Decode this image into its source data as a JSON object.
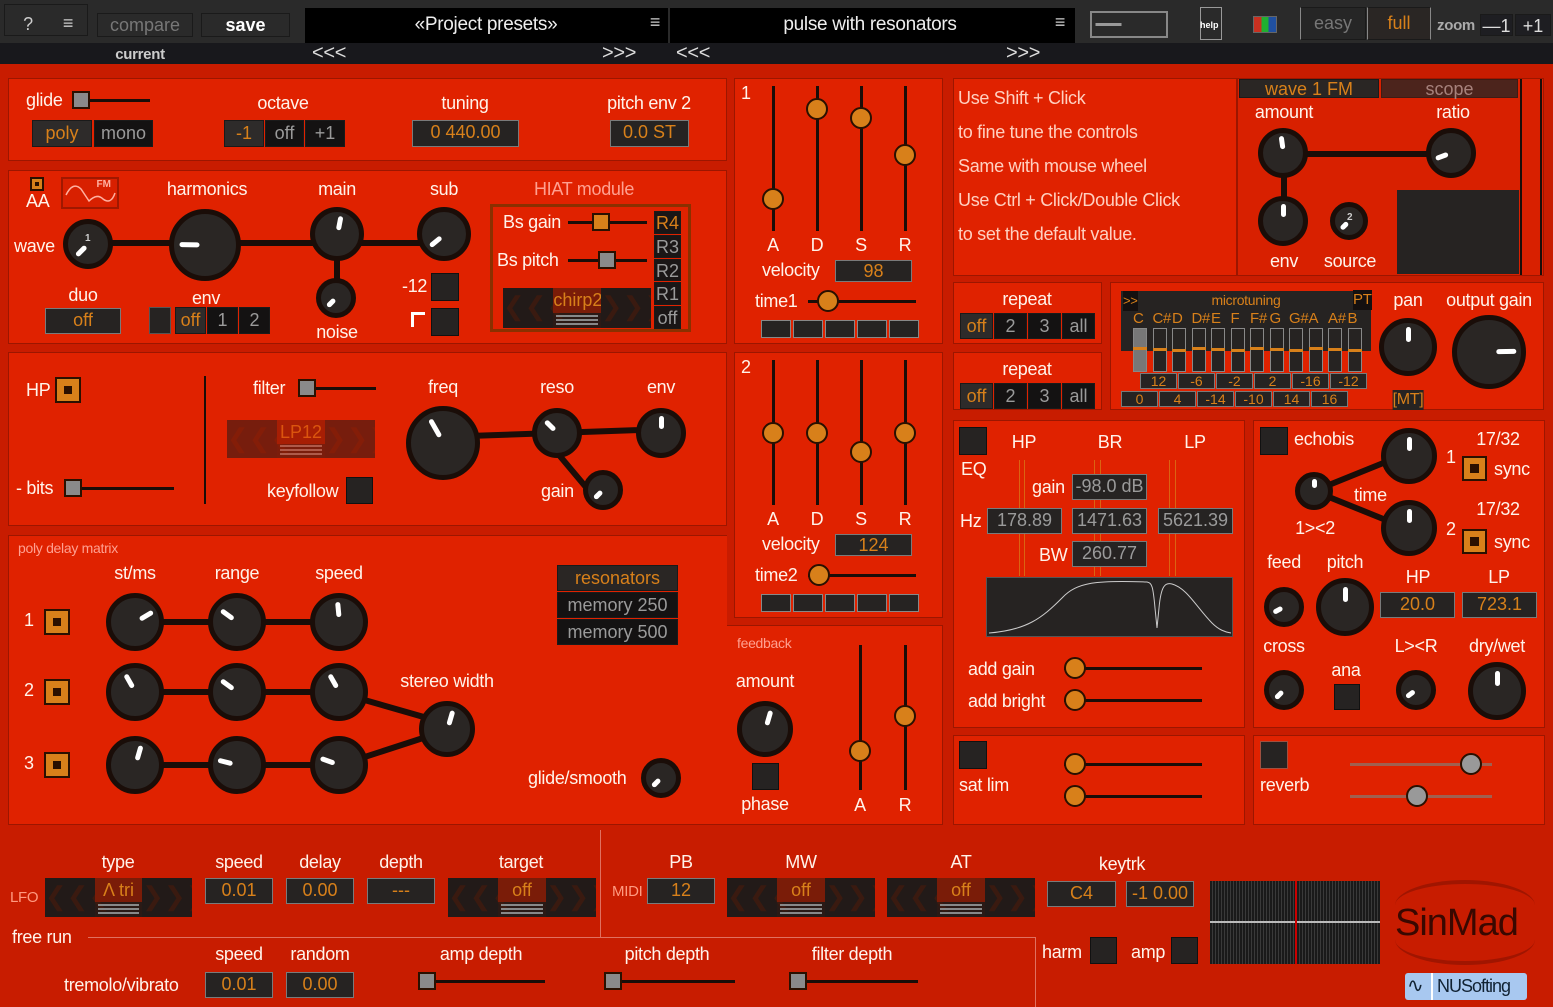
{
  "colors": {
    "panel": "#e02200",
    "background": "#c81c00",
    "accent": "#d8801a",
    "display": "#262322"
  },
  "header": {
    "help": "?",
    "menu": "≡",
    "compare": "compare",
    "save": "save",
    "current": "current",
    "preset_bank": "«Project presets»",
    "preset_name": "pulse with resonators",
    "prev": "<<<",
    "next": ">>>",
    "help_doc": "help",
    "mode_easy": "easy",
    "mode_full": "full",
    "zoom_label": "zoom",
    "zoom_minus": "—1",
    "zoom_plus": "+1"
  },
  "voice": {
    "glide": "glide",
    "glide_value": 0,
    "poly": "poly",
    "mono": "mono",
    "octave": "octave",
    "octave_options": [
      "-1",
      "off",
      "+1"
    ],
    "tuning": "tuning",
    "tuning_value": "0 440.00",
    "pitch_env2": "pitch env 2",
    "pitch_env2_value": "0.0 ST"
  },
  "osc": {
    "aa": "AA",
    "fm": "FM",
    "harmonics": "harmonics",
    "main": "main",
    "sub": "sub",
    "wave": "wave",
    "wave_num": "1",
    "duo": "duo",
    "duo_value": "off",
    "env": "env",
    "env_options": [
      "off",
      "1",
      "2"
    ],
    "noise": "noise",
    "minus12": "-12",
    "knobs": {
      "wave": 0,
      "harmonics": 0.17,
      "main": 0.54,
      "sub": 0.02,
      "noise": 0
    }
  },
  "hiat": {
    "title": "HIAT module",
    "bs_gain": "Bs gain",
    "bs_gain_value": 0.4,
    "bs_pitch": "Bs pitch",
    "bs_pitch_value": 0.5,
    "model": "chirp2",
    "r_buttons": [
      "R4",
      "R3",
      "R2",
      "R1",
      "off"
    ],
    "active": "R4"
  },
  "filter": {
    "hp": "HP",
    "filter": "filter",
    "filter_value": 0,
    "freq": "freq",
    "reso": "reso",
    "env": "env",
    "bits": "- bits",
    "bits_value": 0,
    "keyfollow": "keyfollow",
    "gain": "gain",
    "type": "LP12",
    "knobs": {
      "freq": 0.39,
      "reso": 0.33,
      "env": 0.5,
      "gain": 0
    }
  },
  "delay": {
    "title": "poly delay matrix",
    "st_ms": "st/ms",
    "range": "range",
    "speed": "speed",
    "rows": [
      "1",
      "2",
      "3"
    ],
    "knobs": [
      [
        0.72,
        0.3,
        0.48
      ],
      [
        0.39,
        0.3,
        0.39
      ],
      [
        0.56,
        0.22,
        0.24
      ]
    ],
    "stereo_width": "stereo width",
    "stereo_width_value": 0.56,
    "resonators": [
      "resonators",
      "memory 250",
      "memory 500"
    ],
    "glide_smooth": "glide/smooth",
    "glide_smooth_value": 0
  },
  "feedback": {
    "title": "feedback",
    "amount": "amount",
    "amount_value": 0.56,
    "phase": "phase",
    "a": "A",
    "r": "R",
    "a_value": 0.23,
    "r_value": 0.51
  },
  "env1": {
    "number": "1",
    "labels": [
      "A",
      "D",
      "S",
      "R"
    ],
    "values": [
      0.17,
      0.9,
      0.83,
      0.53
    ],
    "velocity": "velocity",
    "velocity_value": "98",
    "time": "time1",
    "time_value": 0.1
  },
  "env2": {
    "number": "2",
    "labels": [
      "A",
      "D",
      "S",
      "R"
    ],
    "values": [
      0.5,
      0.5,
      0.34,
      0.5
    ],
    "velocity": "velocity",
    "velocity_value": "124",
    "time": "time2",
    "time_value": 0
  },
  "info": {
    "lines": [
      "Use Shift + Click",
      "to fine tune the controls",
      "Same with mouse wheel",
      "Use Ctrl + Click/Double Click",
      "to set the default value."
    ]
  },
  "fm": {
    "tabs": [
      "wave 1 FM",
      "scope"
    ],
    "amount": "amount",
    "ratio": "ratio",
    "env": "env",
    "source": "source",
    "source_num": "2",
    "knobs": {
      "amount": 0.47,
      "ratio": 0.09,
      "env": 0.5,
      "source": 0
    }
  },
  "repeat1": {
    "label": "repeat",
    "options": [
      "off",
      "2",
      "3",
      "all"
    ]
  },
  "repeat2": {
    "label": "repeat",
    "options": [
      "off",
      "2",
      "3",
      "all"
    ]
  },
  "micro": {
    "toggle": ">>",
    "title": "microtuning",
    "pt": "PT",
    "notes": [
      "C",
      "C#",
      "D",
      "D#",
      "E",
      "F",
      "F#",
      "G",
      "G#",
      "A",
      "A#",
      "B"
    ],
    "row1": [
      "12",
      "-6",
      "-2",
      "2",
      "-16",
      "-12"
    ],
    "row2": [
      "0",
      "4",
      "-14",
      "-10",
      "14",
      "16"
    ],
    "pan": "pan",
    "output_gain": "output gain",
    "mt": "[MT]",
    "pan_value": 0.5,
    "output_gain_value": 0.83
  },
  "eq": {
    "eq": "EQ",
    "hp": "HP",
    "br": "BR",
    "lp": "LP",
    "gain": "gain",
    "gain_value": "-98.0 dB",
    "hz": "Hz",
    "hp_value": "178.89",
    "br_value": "1471.63",
    "lp_value": "5621.39",
    "bw": "BW",
    "bw_value": "260.77",
    "add_gain": "add gain",
    "add_bright": "add bright"
  },
  "echo": {
    "echobis": "echobis",
    "time": "time",
    "sync": "sync",
    "sync1": "17/32",
    "sync2": "17/32",
    "one": "1",
    "two": "2",
    "cross12": "1><2",
    "feed": "feed",
    "pitch": "pitch",
    "hp": "HP",
    "lp": "LP",
    "hp_value": "20.0",
    "lp_value": "723.1",
    "cross": "cross",
    "ana": "ana",
    "lr": "L><R",
    "drywet": "dry/wet",
    "knobs": {
      "time1": 0.5,
      "time2": 0.5,
      "cross12": 0.5,
      "feed": 0.06,
      "pitch": 0.5,
      "cross": 0,
      "lr": 0.03,
      "drywet": 0.5
    }
  },
  "sat": {
    "label": "sat lim"
  },
  "reverb": {
    "label": "reverb",
    "slider1": 0.9,
    "slider2": 0.46
  },
  "lfo": {
    "lfo": "LFO",
    "type": "type",
    "type_value": "Λ tri",
    "speed": "speed",
    "speed_value": "0.01",
    "delay": "delay",
    "delay_value": "0.00",
    "depth": "depth",
    "depth_value": "---",
    "target": "target",
    "target_value": "off",
    "free_run": "free run"
  },
  "midi": {
    "midi": "MIDI",
    "pb": "PB",
    "pb_value": "12",
    "mw": "MW",
    "mw_value": "off",
    "at": "AT",
    "at_value": "off",
    "keytrk": "keytrk",
    "key": "C4",
    "key_value": "-1 0.00",
    "harm": "harm",
    "amp": "amp"
  },
  "trem": {
    "speed": "speed",
    "random": "random",
    "label": "tremolo/vibrato",
    "speed_value": "0.01",
    "random_value": "0.00",
    "amp_depth": "amp depth",
    "pitch_depth": "pitch depth",
    "filter_depth": "filter depth"
  },
  "brand": {
    "logo": "SinMad",
    "company": "NUSofting"
  }
}
